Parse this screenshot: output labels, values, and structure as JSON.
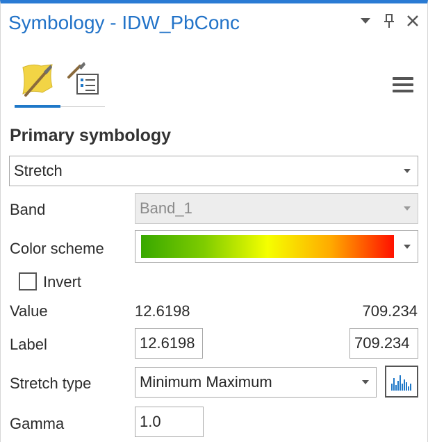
{
  "pane": {
    "title": "Symbology - IDW_PbConc",
    "controls": [
      "options-icon",
      "pin-icon",
      "close-icon"
    ]
  },
  "tabs": [
    {
      "name": "primary-symbology-tab",
      "icon": "paintbrush-icon",
      "active": true
    },
    {
      "name": "vary-symbology-tab",
      "icon": "symbol-list-icon",
      "active": false
    }
  ],
  "section": {
    "title": "Primary symbology"
  },
  "renderer": {
    "value": "Stretch"
  },
  "band": {
    "label": "Band",
    "value": "Band_1",
    "enabled": false
  },
  "color_scheme": {
    "label": "Color scheme",
    "colors": [
      "#38a800",
      "#7fcc00",
      "#f5ff00",
      "#ffaa00",
      "#ff1100"
    ]
  },
  "invert": {
    "label": "Invert",
    "checked": false
  },
  "value_row": {
    "label": "Value",
    "min": "12.6198",
    "max": "709.234"
  },
  "label_row": {
    "label": "Label",
    "min": "12.6198",
    "max": "709.234"
  },
  "stretch_type": {
    "label": "Stretch type",
    "value": "Minimum Maximum"
  },
  "gamma": {
    "label": "Gamma",
    "value": "1.0"
  },
  "colors": {
    "accent": "#2273c8",
    "tab_underline": "#1f78c8"
  }
}
